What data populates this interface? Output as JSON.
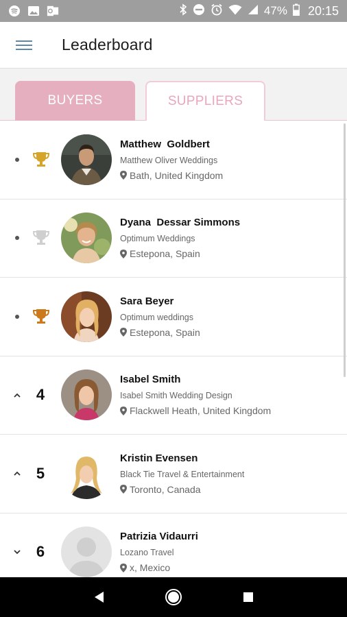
{
  "status_bar": {
    "battery": "47%",
    "time": "20:15",
    "left_icons": [
      "spotify-icon",
      "gallery-icon",
      "outlook-icon"
    ],
    "right_icons": [
      "bluetooth-icon",
      "dnd-icon",
      "alarm-icon",
      "wifi-icon",
      "signal-icon",
      "battery-icon"
    ]
  },
  "app_bar": {
    "title": "Leaderboard"
  },
  "tabs": {
    "buyers": "BUYERS",
    "suppliers": "SUPPLIERS",
    "active": "BUYERS"
  },
  "colors": {
    "accent_pink": "#e6afc0",
    "gold": "#d4a52a",
    "silver": "#cfcfcf",
    "bronze": "#cd7a1d",
    "menu_blue": "#5f87a8"
  },
  "leaderboard": [
    {
      "trend": "dot",
      "rank": "",
      "trophy": "gold",
      "name": "Matthew  Goldbert",
      "company": "Matthew Oliver Weddings",
      "location": "Bath, United Kingdom"
    },
    {
      "trend": "dot",
      "rank": "",
      "trophy": "silver",
      "name": "Dyana  Dessar Simmons",
      "company": "Optimum Weddings",
      "location": "Estepona, Spain"
    },
    {
      "trend": "dot",
      "rank": "",
      "trophy": "bronze",
      "name": "Sara Beyer",
      "company": "Optimum weddings",
      "location": "Estepona, Spain"
    },
    {
      "trend": "up",
      "rank": "4",
      "trophy": "",
      "name": "Isabel Smith",
      "company": "Isabel Smith Wedding Design",
      "location": "Flackwell Heath, United Kingdom"
    },
    {
      "trend": "up",
      "rank": "5",
      "trophy": "",
      "name": "Kristin Evensen",
      "company": "Black Tie Travel & Entertainment",
      "location": "Toronto, Canada"
    },
    {
      "trend": "down",
      "rank": "6",
      "trophy": "",
      "name": "Patrizia Vidaurri",
      "company": "Lozano Travel",
      "location": "x, Mexico"
    }
  ]
}
